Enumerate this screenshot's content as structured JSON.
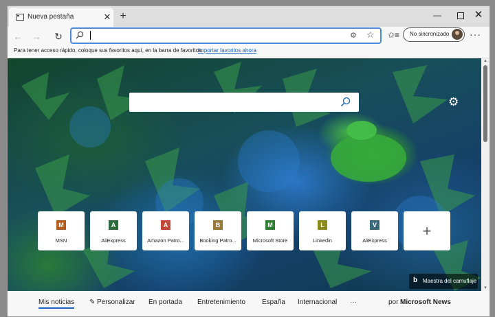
{
  "tab": {
    "title": "Nueva pestaña",
    "close": "✕",
    "new_tab": "+"
  },
  "window_controls": {
    "minimize": "—",
    "close": "✕"
  },
  "toolbar": {
    "back": "←",
    "forward": "→",
    "reload": "↻",
    "address_value": "",
    "favorites_icon": "✩≡",
    "more": "···"
  },
  "profile": {
    "label": "No sincronizado"
  },
  "favorites_bar": {
    "message": "Para tener acceso rápido, coloque sus favoritos aquí, en la barra de favoritos.",
    "import_link": "Importar favoritos ahora"
  },
  "search": {
    "value": ""
  },
  "tiles": [
    {
      "letter": "M",
      "label": "MSN",
      "color": "#b35c1e"
    },
    {
      "letter": "A",
      "label": "AliExpress",
      "color": "#2e6b3a"
    },
    {
      "letter": "A",
      "label": "Amazon Patro...",
      "color": "#c04a3a"
    },
    {
      "letter": "B",
      "label": "Booking Patro...",
      "color": "#9a7a3a"
    },
    {
      "letter": "M",
      "label": "Microsoft Store",
      "color": "#2e7d32"
    },
    {
      "letter": "L",
      "label": "Linkedin",
      "color": "#8a8a1a"
    },
    {
      "letter": "V",
      "label": "AliExpress",
      "color": "#3a6a7a"
    }
  ],
  "add_tile": "+",
  "image_credit": {
    "text": "Maestra del camuflaje"
  },
  "news": {
    "items": [
      "Mis noticias",
      "Personalizar",
      "En portada",
      "Entretenimiento",
      "España",
      "Internacional"
    ],
    "more": "···",
    "by": "por",
    "brand": "Microsoft News"
  }
}
